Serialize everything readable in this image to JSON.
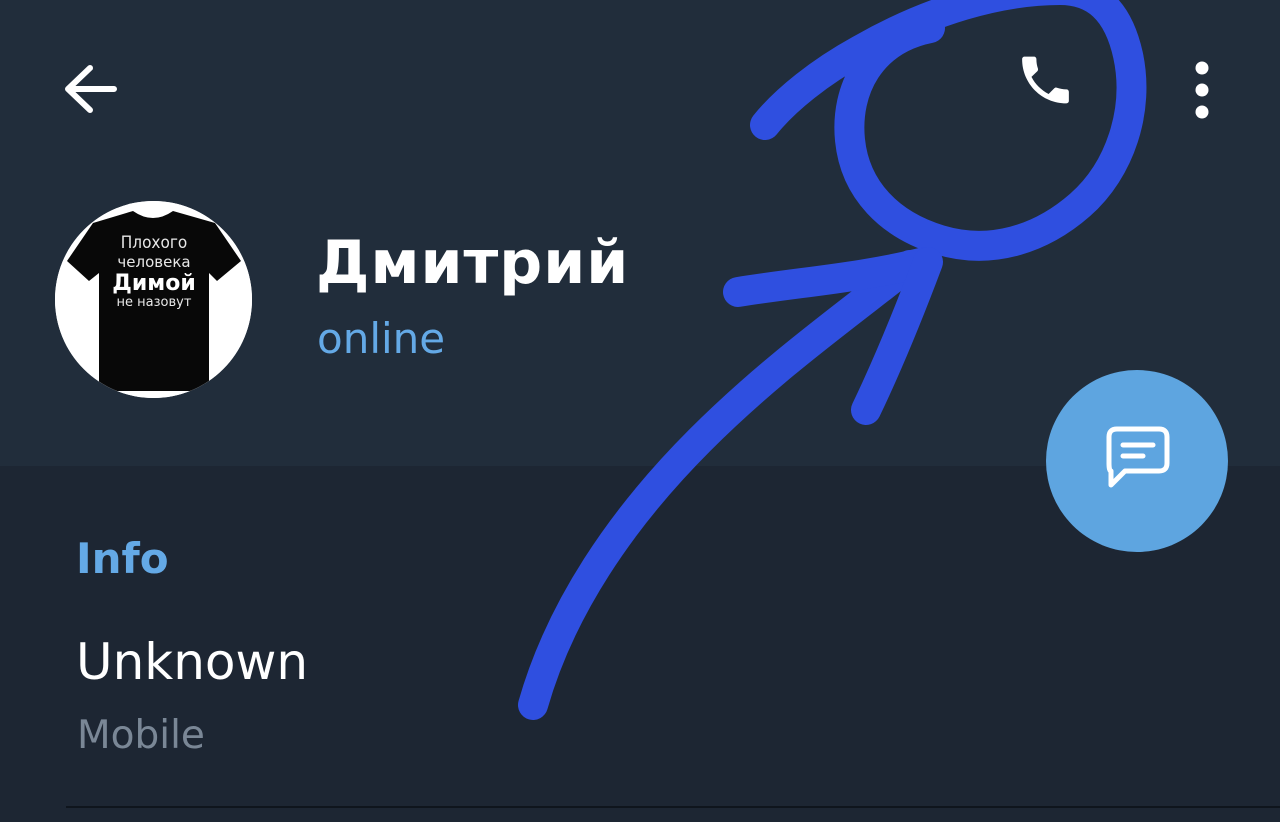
{
  "toolbar": {
    "back_icon": "arrow-left-icon",
    "call_icon": "phone-icon",
    "menu_icon": "more-vertical-icon"
  },
  "profile": {
    "name": "Дмитрий",
    "status": "online",
    "avatar_text": [
      "Плохого",
      "человека",
      "Димой",
      "не назовут"
    ]
  },
  "fab": {
    "icon": "message-icon"
  },
  "info": {
    "section_title": "Info",
    "phone_value": "Unknown",
    "phone_label": "Mobile"
  },
  "colors": {
    "header_bg": "#212d3b",
    "body_bg": "#1d2633",
    "accent": "#64a9e6",
    "fab_bg": "#5ea5e0",
    "annotation_stroke": "#2f4fe0"
  }
}
